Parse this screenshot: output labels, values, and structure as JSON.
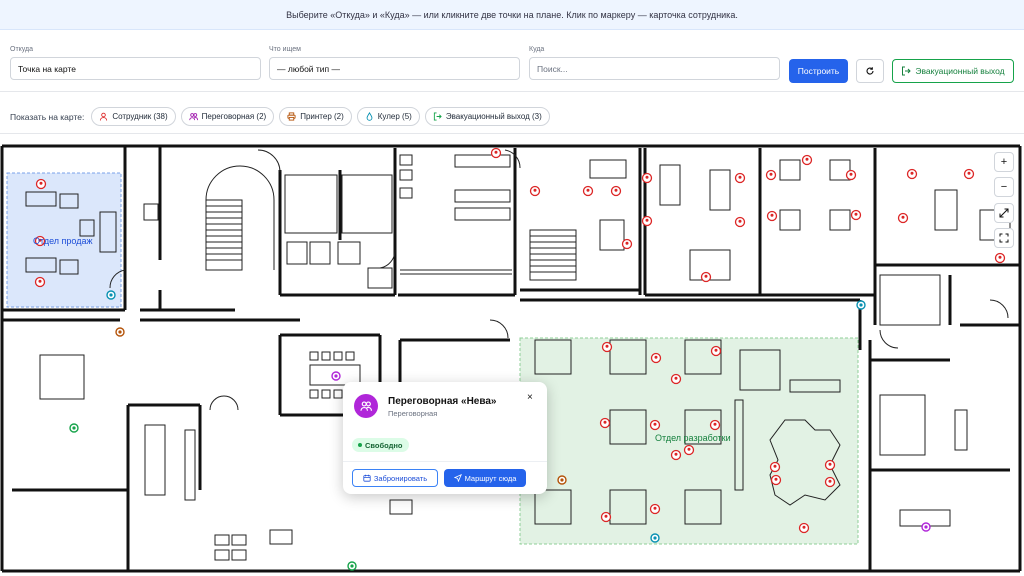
{
  "hint": "Выберите «Откуда» и «Куда» — или кликните две точки на плане. Клик по маркеру — карточка сотрудника.",
  "route": {
    "from_label": "Откуда",
    "from_value": "Точка на карте",
    "what_label": "Что ищем",
    "what_value": "— любой тип —",
    "to_label": "Куда",
    "to_placeholder": "Поиск...",
    "build_button": "Построить",
    "evac_button": "Эвакуационный выход"
  },
  "filters": {
    "label": "Показать на карте:",
    "chips": [
      {
        "label": "Сотрудник (38)",
        "icon": "person-icon",
        "color": "#dc2626"
      },
      {
        "label": "Переговорная (2)",
        "icon": "people-icon",
        "color": "#a21caf"
      },
      {
        "label": "Принтер (2)",
        "icon": "printer-icon",
        "color": "#b45309"
      },
      {
        "label": "Кулер (5)",
        "icon": "drop-icon",
        "color": "#0891b2"
      },
      {
        "label": "Эвакуационный выход (3)",
        "icon": "exit-icon",
        "color": "#16a34a"
      }
    ]
  },
  "map": {
    "departments": [
      {
        "name": "Отдел продаж",
        "color": "#1d4ed8"
      },
      {
        "name": "Отдел разработки",
        "color": "#15803d"
      }
    ],
    "zoom_in": "+",
    "zoom_out": "−"
  },
  "popup": {
    "title": "Переговорная «Нева»",
    "subtitle": "Переговорная",
    "status": "Свободно",
    "book_button": "Забронировать",
    "route_button": "Маршрут сюда",
    "close": "×"
  },
  "colors": {
    "accent": "#2563eb",
    "employee": "#dc2626",
    "room": "#b026d9",
    "evac": "#16a34a"
  }
}
